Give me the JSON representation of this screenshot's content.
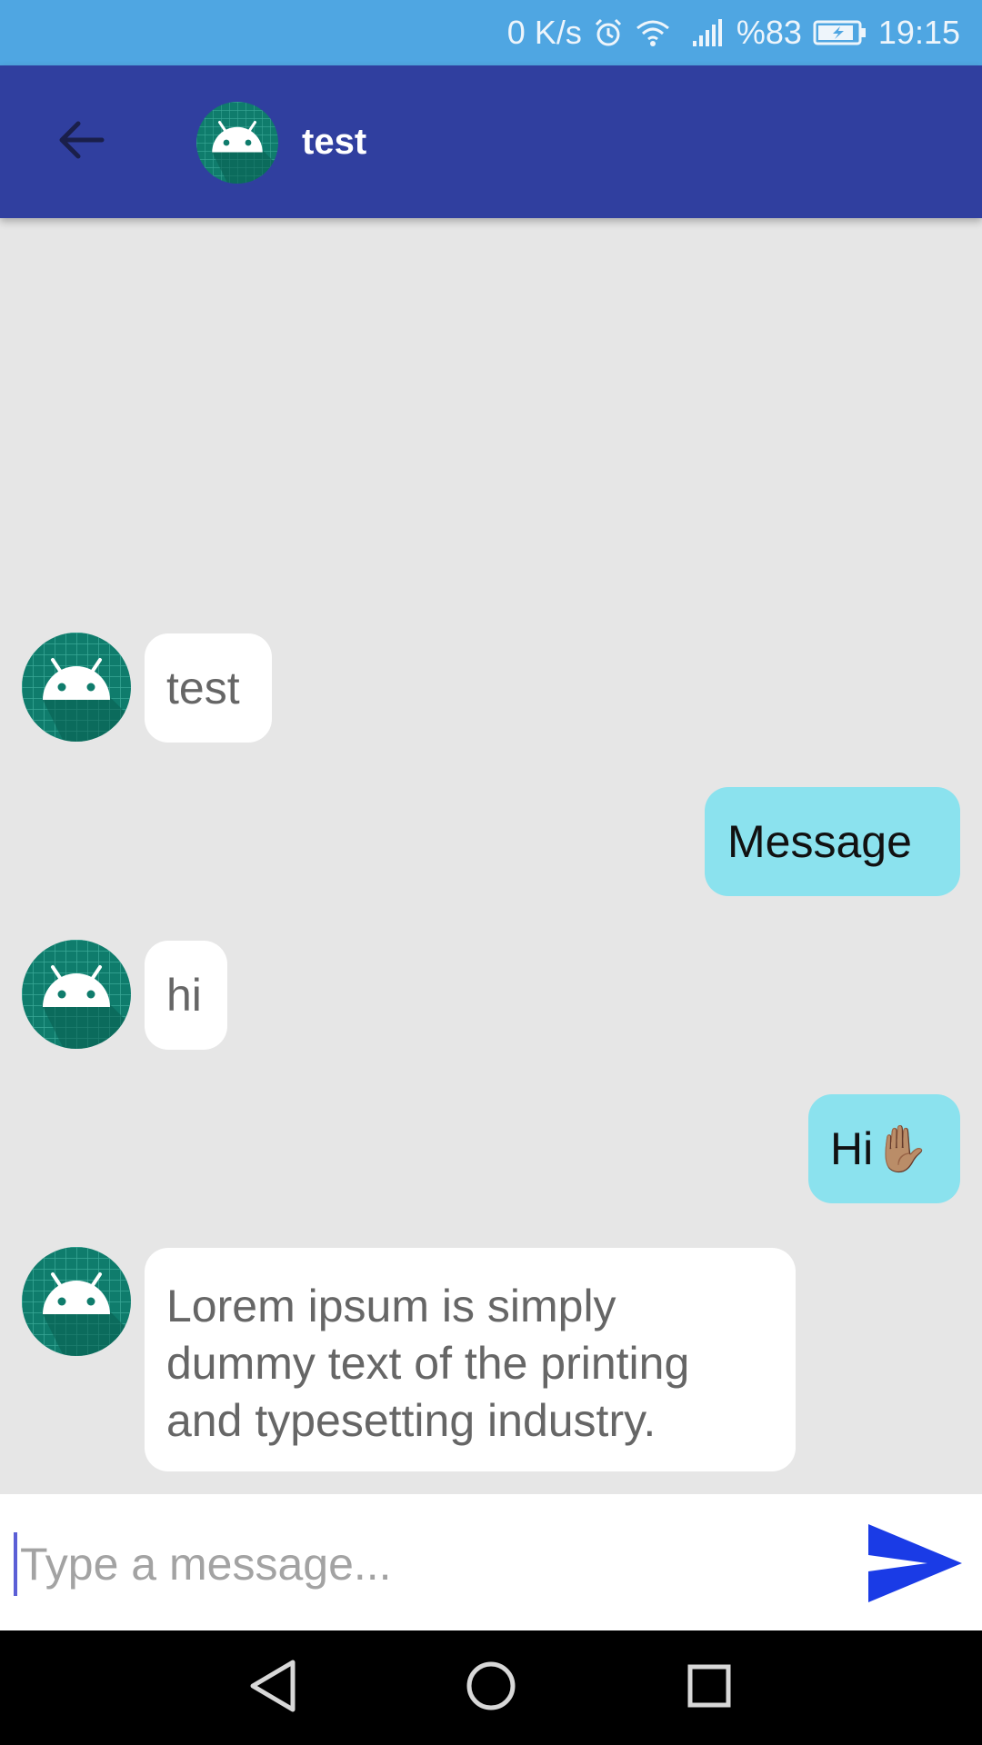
{
  "status_bar": {
    "net_speed": "0 K/s",
    "battery": "%83",
    "time": "19:15",
    "icons": [
      "alarm-icon",
      "wifi-icon",
      "signal-icon",
      "battery-charging-icon"
    ]
  },
  "header": {
    "title": "test",
    "back_icon": "arrow-left-icon",
    "avatar_icon": "android-avatar"
  },
  "messages": [
    {
      "direction": "incoming",
      "text": "test"
    },
    {
      "direction": "outgoing",
      "text": "Message"
    },
    {
      "direction": "incoming",
      "text": "hi"
    },
    {
      "direction": "outgoing",
      "text": "Hi✋🏽"
    },
    {
      "direction": "incoming",
      "text": "Lorem ipsum is simply dummy text of the printing and typesetting industry."
    }
  ],
  "composer": {
    "placeholder": "Type a message...",
    "value": "",
    "send_icon": "send-icon"
  },
  "colors": {
    "status_bar": "#4fa6e2",
    "app_bar": "#303f9f",
    "outgoing_bubble": "#8be2ee",
    "incoming_bubble": "#ffffff",
    "chat_background": "#e6e6e6",
    "send_accent": "#1a3be6"
  },
  "nav_bar": {
    "icons": [
      "nav-back-icon",
      "nav-home-icon",
      "nav-recents-icon"
    ]
  }
}
